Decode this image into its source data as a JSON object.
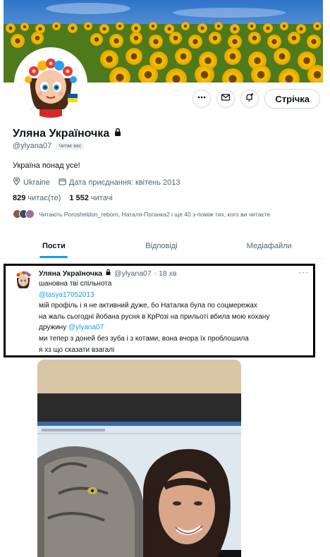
{
  "profile": {
    "display_name": "Уляна Україночка",
    "handle": "@ylyana07",
    "follows_you_badge": "Читає вас",
    "bio": "Україна понад усе!",
    "location": "Ukraine",
    "joined": "Дата приєднання: квітень 2013",
    "following_count": "829",
    "following_label": "читає(те)",
    "followers_count": "1 552",
    "followers_label": "читачі",
    "followed_by_text": "Читають Porosheldon_reborn, Наталя-Поганка2 і ще 40 з-поміж тих, кого ви читаєте"
  },
  "actions": {
    "follow_label": "Стрічка",
    "more_icon": "more-icon",
    "message_icon": "mail-icon",
    "notify_icon": "bell-plus-icon"
  },
  "tabs": [
    {
      "label": "Пости",
      "active": true
    },
    {
      "label": "Відповіді",
      "active": false
    },
    {
      "label": "Медіафайли",
      "active": false
    }
  ],
  "tweet": {
    "author_name": "Уляна Україночка",
    "author_handle": "@ylyana07",
    "time": "· 18 хв",
    "more": "···",
    "lines": [
      {
        "text": "шановна тві спільнота",
        "mention": false
      },
      {
        "text": "@tasya17052013",
        "mention": true
      },
      {
        "text": "мій профіль і я не активний дуже, бо Наталка була по соцмережах",
        "mention": false
      },
      {
        "text": "на жаль сьогодні йобана русня в КрРозі на прильоті вбила мою кохану",
        "mention": false
      },
      {
        "text": "дружину",
        "mention": false,
        "suffix_mention": "@ylyana07"
      },
      {
        "text": "ми тепер з доней без зуба і з котами, вона вчора їх проблошила",
        "mention": false
      },
      {
        "text": "я хз що сказати взагалі",
        "mention": false
      }
    ]
  },
  "colors": {
    "accent": "#1d9bf0",
    "text": "#0f1419",
    "muted": "#536471",
    "border": "#cfd9de"
  }
}
